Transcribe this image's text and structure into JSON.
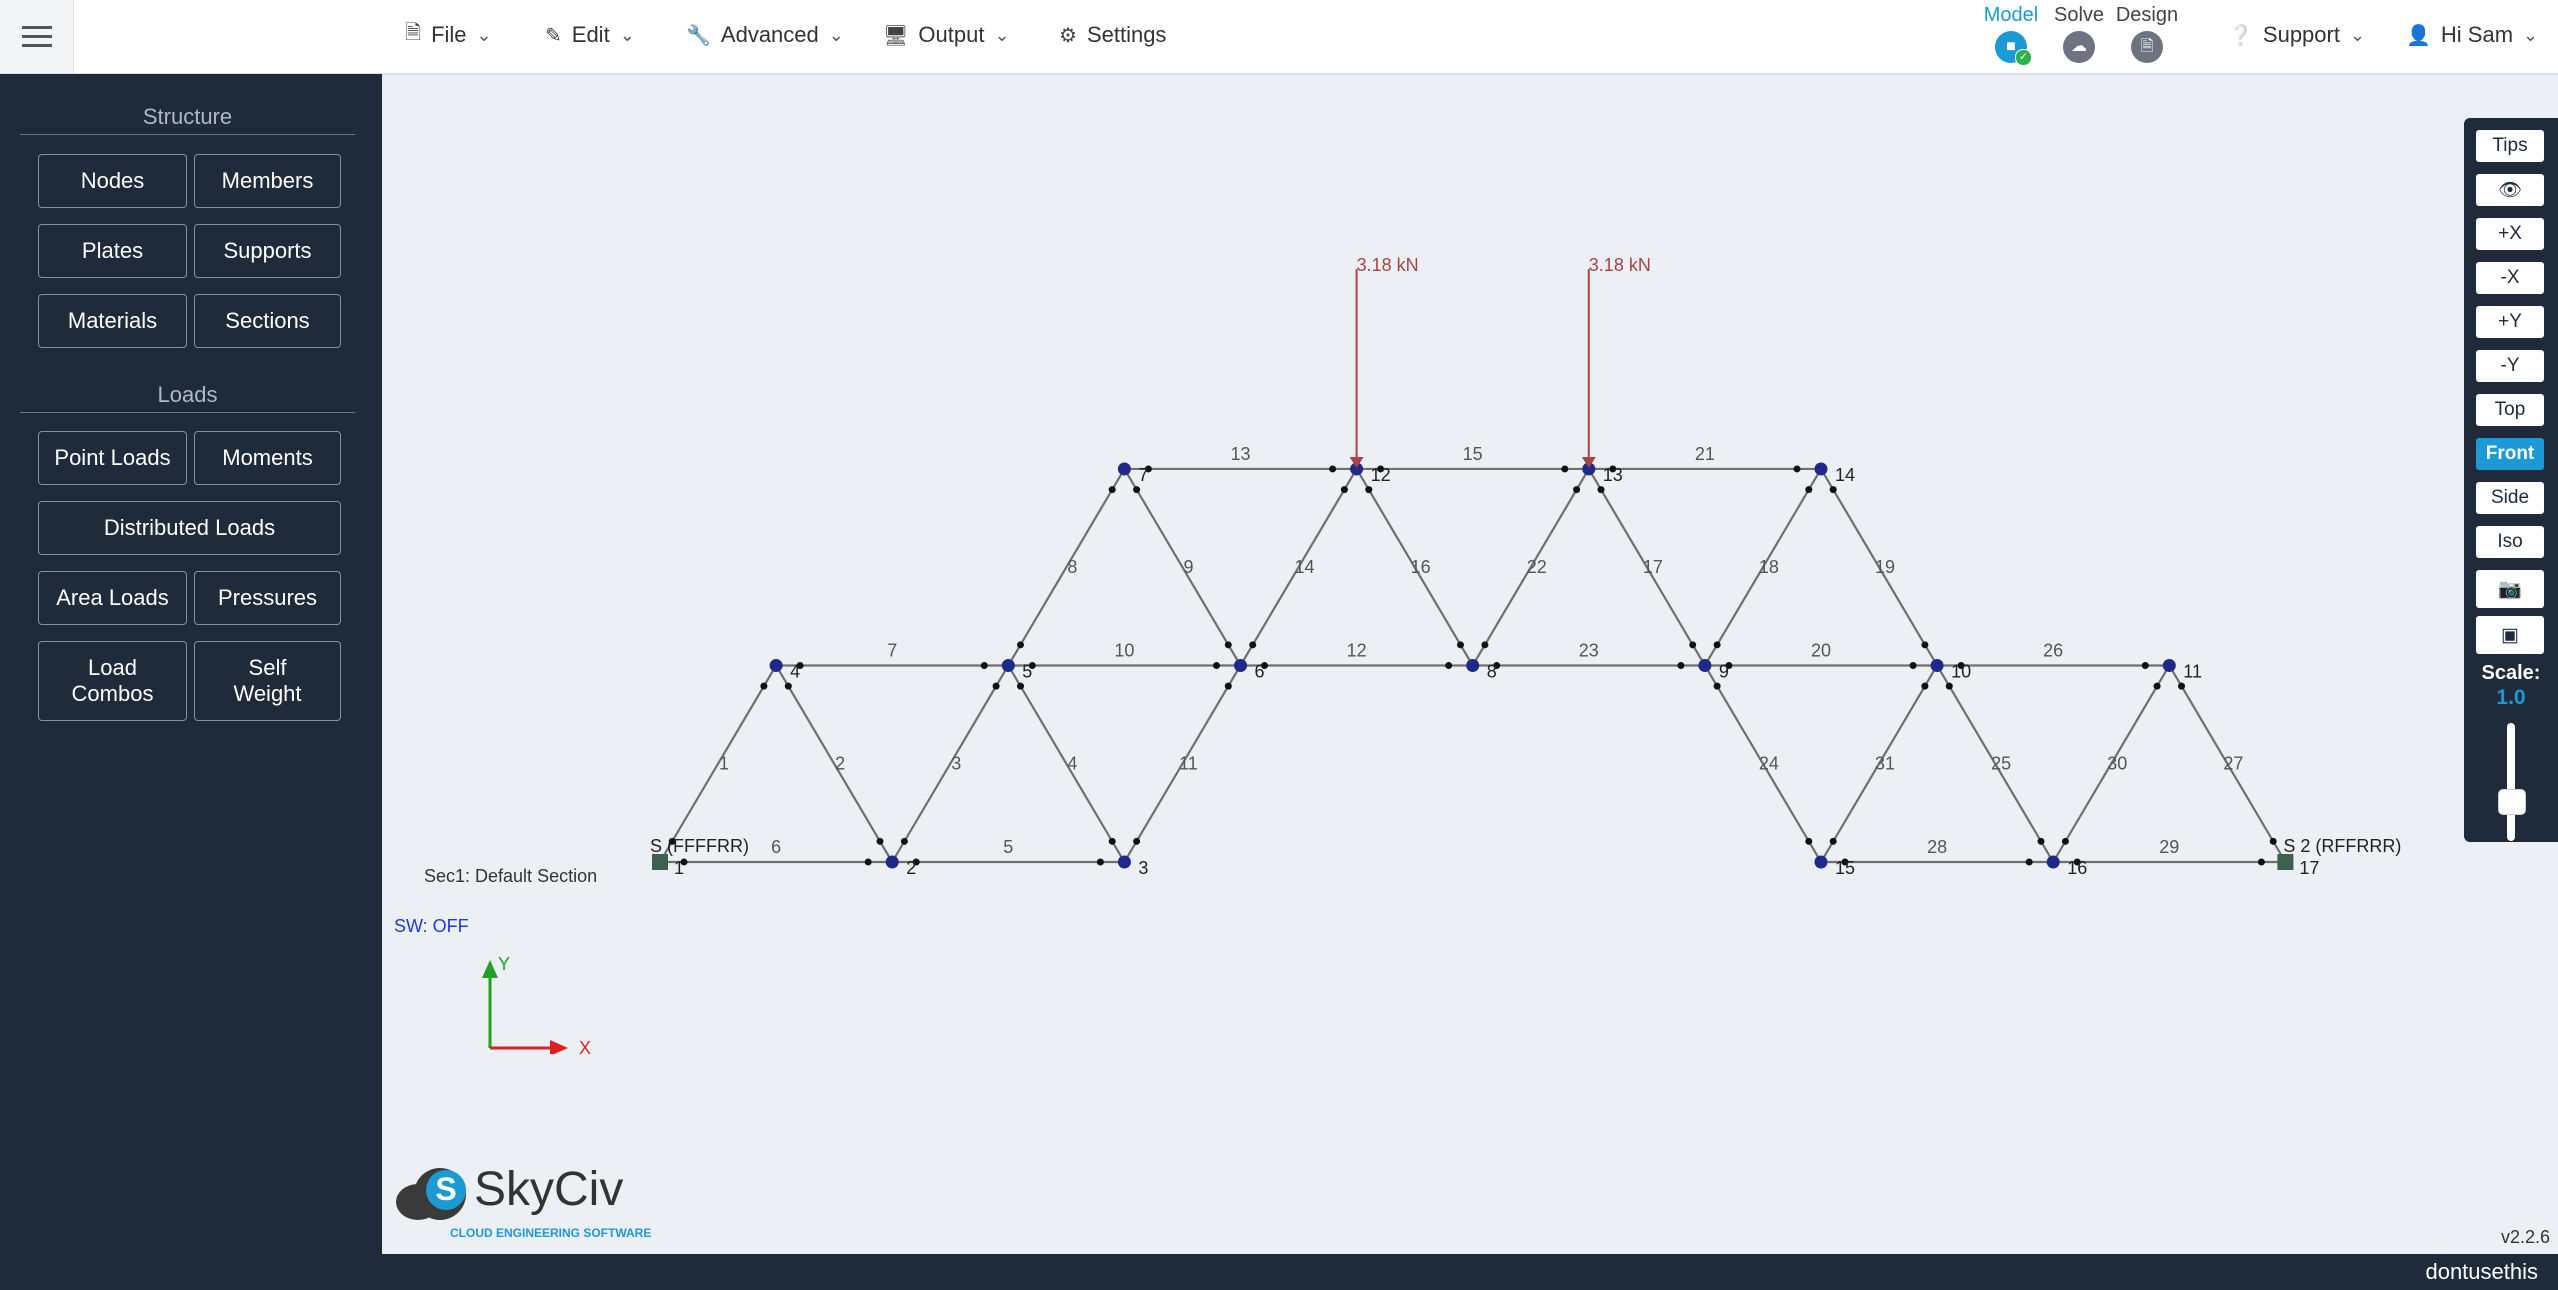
{
  "topbar": {
    "menu": [
      {
        "icon": "file-icon",
        "label": "File"
      },
      {
        "icon": "pencil-icon",
        "label": "Edit"
      },
      {
        "icon": "wrench-icon",
        "label": "Advanced"
      },
      {
        "icon": "monitor-icon",
        "label": "Output"
      },
      {
        "icon": "gear-icon",
        "label": "Settings"
      }
    ],
    "modes": [
      {
        "label": "Model",
        "icon": "model-icon",
        "active": true
      },
      {
        "label": "Solve",
        "icon": "cloud-icon",
        "active": false
      },
      {
        "label": "Design",
        "icon": "document-icon",
        "active": false
      }
    ],
    "support": "Support",
    "user": "Hi Sam"
  },
  "sidebar": {
    "structure_title": "Structure",
    "loads_title": "Loads",
    "structure_buttons": [
      "Nodes",
      "Members",
      "Plates",
      "Supports",
      "Materials",
      "Sections"
    ],
    "loads_buttons": [
      "Point Loads",
      "Moments",
      "Distributed Loads",
      "Area Loads",
      "Pressures",
      "Load Combos",
      "Self Weight"
    ]
  },
  "toolbar": {
    "buttons": [
      "Tips",
      "eye-icon",
      "+X",
      "-X",
      "+Y",
      "-Y",
      "Top",
      "Front",
      "Side",
      "Iso",
      "camera-icon",
      "cube-icon"
    ],
    "active": "Front",
    "scale_label": "Scale:",
    "scale_value": "1.0",
    "scale_slider_level": 0.3
  },
  "canvas": {
    "section_label": "Sec1: Default Section",
    "self_weight": "SW: OFF",
    "axis_y": "Y",
    "axis_x": "X",
    "version": "v2.2.6",
    "logo_name": "SkyCiv",
    "logo_tagline": "CLOUD ENGINEERING SOFTWARE",
    "support_labels": [
      {
        "node": 1,
        "text": "S (FFFFRR)"
      },
      {
        "node": 17,
        "text": "S 2 (RFFRRR)"
      }
    ],
    "loads": [
      {
        "node": 12,
        "text": "3.18 kN"
      },
      {
        "node": 13,
        "text": "3.18 kN"
      }
    ]
  },
  "model": {
    "nodes": [
      {
        "id": 1,
        "x": 0,
        "y": 0
      },
      {
        "id": 2,
        "x": 2,
        "y": 0
      },
      {
        "id": 3,
        "x": 4,
        "y": 0
      },
      {
        "id": 4,
        "x": 1,
        "y": 1.7
      },
      {
        "id": 5,
        "x": 3,
        "y": 1.7
      },
      {
        "id": 6,
        "x": 5,
        "y": 1.7
      },
      {
        "id": 7,
        "x": 4,
        "y": 3.4
      },
      {
        "id": 8,
        "x": 7,
        "y": 1.7
      },
      {
        "id": 9,
        "x": 9,
        "y": 1.7
      },
      {
        "id": 10,
        "x": 11,
        "y": 1.7
      },
      {
        "id": 11,
        "x": 13,
        "y": 1.7
      },
      {
        "id": 12,
        "x": 6,
        "y": 3.4
      },
      {
        "id": 13,
        "x": 8,
        "y": 3.4
      },
      {
        "id": 14,
        "x": 10,
        "y": 3.4
      },
      {
        "id": 15,
        "x": 10,
        "y": 0
      },
      {
        "id": 16,
        "x": 12,
        "y": 0
      },
      {
        "id": 17,
        "x": 14,
        "y": 0
      }
    ],
    "members": [
      {
        "id": 1,
        "n1": 1,
        "n2": 4
      },
      {
        "id": 2,
        "n1": 4,
        "n2": 2
      },
      {
        "id": 3,
        "n1": 2,
        "n2": 5
      },
      {
        "id": 4,
        "n1": 5,
        "n2": 3
      },
      {
        "id": 5,
        "n1": 2,
        "n2": 3
      },
      {
        "id": 6,
        "n1": 1,
        "n2": 2
      },
      {
        "id": 7,
        "n1": 4,
        "n2": 5
      },
      {
        "id": 8,
        "n1": 5,
        "n2": 7
      },
      {
        "id": 9,
        "n1": 7,
        "n2": 6
      },
      {
        "id": 10,
        "n1": 5,
        "n2": 6
      },
      {
        "id": 11,
        "n1": 3,
        "n2": 6
      },
      {
        "id": 12,
        "n1": 6,
        "n2": 8
      },
      {
        "id": 13,
        "n1": 7,
        "n2": 12
      },
      {
        "id": 14,
        "n1": 6,
        "n2": 12
      },
      {
        "id": 15,
        "n1": 12,
        "n2": 13
      },
      {
        "id": 16,
        "n1": 12,
        "n2": 8
      },
      {
        "id": 17,
        "n1": 13,
        "n2": 9
      },
      {
        "id": 18,
        "n1": 9,
        "n2": 14
      },
      {
        "id": 19,
        "n1": 14,
        "n2": 10
      },
      {
        "id": 20,
        "n1": 9,
        "n2": 10
      },
      {
        "id": 21,
        "n1": 13,
        "n2": 14
      },
      {
        "id": 22,
        "n1": 8,
        "n2": 13
      },
      {
        "id": 23,
        "n1": 8,
        "n2": 9
      },
      {
        "id": 24,
        "n1": 9,
        "n2": 15
      },
      {
        "id": 25,
        "n1": 10,
        "n2": 16
      },
      {
        "id": 26,
        "n1": 10,
        "n2": 11
      },
      {
        "id": 27,
        "n1": 11,
        "n2": 17
      },
      {
        "id": 28,
        "n1": 15,
        "n2": 16
      },
      {
        "id": 29,
        "n1": 16,
        "n2": 17
      },
      {
        "id": 30,
        "n1": 16,
        "n2": 11
      },
      {
        "id": 31,
        "n1": 15,
        "n2": 10
      }
    ],
    "supports": [
      1,
      17
    ],
    "loaded_nodes": [
      12,
      13
    ]
  },
  "colors": {
    "sidebar_bg": "#1f2a3a",
    "accent": "#1c9ad6",
    "member": "#6f6f6f",
    "node": "#1e2a8a",
    "load": "#a94442",
    "support": "#3f5f4f",
    "axis_x": "#e02020",
    "axis_y": "#22a022"
  }
}
